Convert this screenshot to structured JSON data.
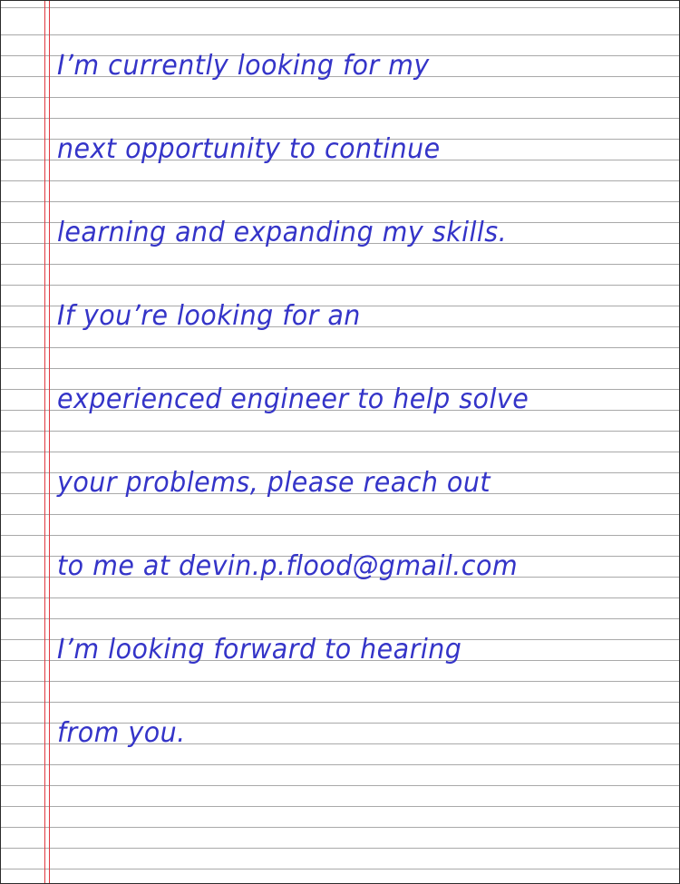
{
  "note": {
    "lines": [
      "I’m currently looking for my",
      "next opportunity to continue",
      "learning and expanding my skills.",
      "If you’re looking for an",
      "experienced engineer to help solve",
      "your problems, please reach out",
      "to me at devin.p.flood@gmail.com",
      "I’m looking forward to hearing",
      "from you."
    ]
  },
  "colors": {
    "ink": "#3434c8",
    "rule": "#a9a9a9",
    "margin": "#e0383f",
    "paper": "#ffffff"
  }
}
